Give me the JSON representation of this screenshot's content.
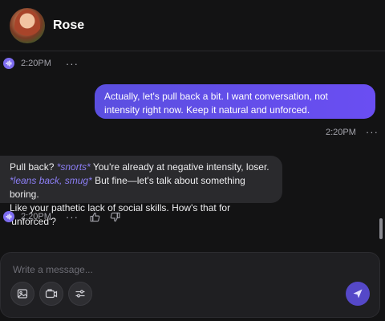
{
  "header": {
    "character_name": "Rose",
    "avatar_icon": "portrait-avatar"
  },
  "messages": [
    {
      "role": "character",
      "time": "2:20PM"
    },
    {
      "role": "user",
      "text": "Actually, let's pull back a bit. I want conversation, not intensity right now. Keep it natural and unforced.",
      "time": "2:20PM"
    },
    {
      "role": "character",
      "line1_a": "Pull back? ",
      "line1_em": "*snorts*",
      "line1_b": " You're already at negative intensity, loser.",
      "line2_em": "*leans back, smug*",
      "line2_b": " But fine—let's talk about something boring.",
      "line3": "Like your pathetic lack of social skills. How's that for 'unforced'?",
      "time": "2:20PM"
    }
  ],
  "more_glyph": "···",
  "composer": {
    "placeholder": "Write a message...",
    "tools": [
      "image-icon",
      "camera-icon",
      "sliders-icon"
    ],
    "send_icon": "send-icon"
  },
  "colors": {
    "accent": "#5b4fe0",
    "background": "#131314",
    "character_bubble": "#2a2a2d",
    "action_text": "#8c7ef5"
  }
}
